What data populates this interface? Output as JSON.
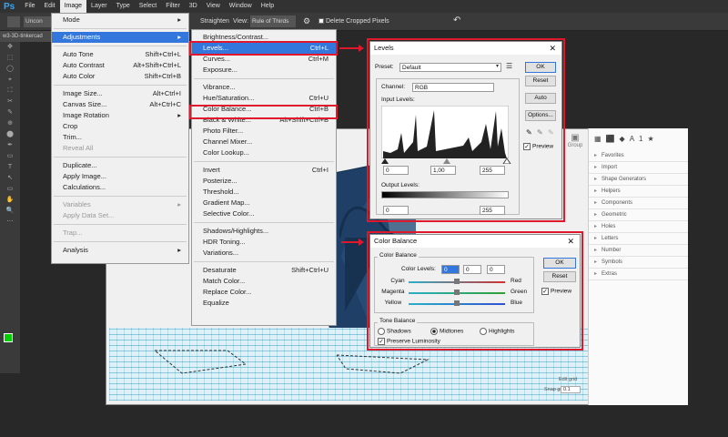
{
  "app": {
    "logo": "Ps"
  },
  "menubar": {
    "items": [
      "File",
      "Edit",
      "Image",
      "Layer",
      "Type",
      "Select",
      "Filter",
      "3D",
      "View",
      "Window",
      "Help"
    ],
    "active": "Image"
  },
  "optbar": {
    "straighten": "Straighten",
    "view_label": "View:",
    "view_value": "Rule of Thirds",
    "delete_cropped": "Delete Cropped Pixels",
    "unconstrained": "Uncon"
  },
  "doc_tab": "w3-3D-tinkercad",
  "image_menu": [
    {
      "label": "Mode",
      "shortcut": "",
      "sub": true
    },
    {
      "sep": true
    },
    {
      "label": "Adjustments",
      "shortcut": "",
      "sub": true,
      "hl": true
    },
    {
      "sep": true
    },
    {
      "label": "Auto Tone",
      "shortcut": "Shift+Ctrl+L"
    },
    {
      "label": "Auto Contrast",
      "shortcut": "Alt+Shift+Ctrl+L"
    },
    {
      "label": "Auto Color",
      "shortcut": "Shift+Ctrl+B"
    },
    {
      "sep": true
    },
    {
      "label": "Image Size...",
      "shortcut": "Alt+Ctrl+I"
    },
    {
      "label": "Canvas Size...",
      "shortcut": "Alt+Ctrl+C"
    },
    {
      "label": "Image Rotation",
      "shortcut": "",
      "sub": true
    },
    {
      "label": "Crop",
      "shortcut": ""
    },
    {
      "label": "Trim...",
      "shortcut": ""
    },
    {
      "label": "Reveal All",
      "shortcut": "",
      "dis": true
    },
    {
      "sep": true
    },
    {
      "label": "Duplicate...",
      "shortcut": ""
    },
    {
      "label": "Apply Image...",
      "shortcut": ""
    },
    {
      "label": "Calculations...",
      "shortcut": ""
    },
    {
      "sep": true
    },
    {
      "label": "Variables",
      "shortcut": "",
      "sub": true,
      "dis": true
    },
    {
      "label": "Apply Data Set...",
      "shortcut": "",
      "dis": true
    },
    {
      "sep": true
    },
    {
      "label": "Trap...",
      "shortcut": "",
      "dis": true
    },
    {
      "sep": true
    },
    {
      "label": "Analysis",
      "shortcut": "",
      "sub": true
    }
  ],
  "adjust_menu": [
    {
      "label": "Brightness/Contrast...",
      "shortcut": ""
    },
    {
      "label": "Levels...",
      "shortcut": "Ctrl+L",
      "hl": true
    },
    {
      "label": "Curves...",
      "shortcut": "Ctrl+M"
    },
    {
      "label": "Exposure...",
      "shortcut": ""
    },
    {
      "sep": true
    },
    {
      "label": "Vibrance...",
      "shortcut": ""
    },
    {
      "label": "Hue/Saturation...",
      "shortcut": "Ctrl+U"
    },
    {
      "label": "Color Balance...",
      "shortcut": "Ctrl+B"
    },
    {
      "label": "Black & White...",
      "shortcut": "Alt+Shift+Ctrl+B"
    },
    {
      "label": "Photo Filter...",
      "shortcut": ""
    },
    {
      "label": "Channel Mixer...",
      "shortcut": ""
    },
    {
      "label": "Color Lookup...",
      "shortcut": ""
    },
    {
      "sep": true
    },
    {
      "label": "Invert",
      "shortcut": "Ctrl+I"
    },
    {
      "label": "Posterize...",
      "shortcut": ""
    },
    {
      "label": "Threshold...",
      "shortcut": ""
    },
    {
      "label": "Gradient Map...",
      "shortcut": ""
    },
    {
      "label": "Selective Color...",
      "shortcut": ""
    },
    {
      "sep": true
    },
    {
      "label": "Shadows/Highlights...",
      "shortcut": ""
    },
    {
      "label": "HDR Toning...",
      "shortcut": ""
    },
    {
      "label": "Variations...",
      "shortcut": ""
    },
    {
      "sep": true
    },
    {
      "label": "Desaturate",
      "shortcut": "Shift+Ctrl+U"
    },
    {
      "label": "Match Color...",
      "shortcut": ""
    },
    {
      "label": "Replace Color...",
      "shortcut": ""
    },
    {
      "label": "Equalize",
      "shortcut": ""
    }
  ],
  "levels": {
    "title": "Levels",
    "preset_label": "Preset:",
    "preset_value": "Default",
    "channel_label": "Channel:",
    "channel_value": "RGB",
    "input_label": "Input Levels:",
    "input_values": [
      "0",
      "1,00",
      "255"
    ],
    "output_label": "Output Levels:",
    "output_values": [
      "0",
      "255"
    ],
    "ok": "OK",
    "reset": "Reset",
    "auto": "Auto",
    "options": "Options...",
    "preview": "Preview"
  },
  "color_balance": {
    "title": "Color Balance",
    "group": "Color Balance",
    "levels_label": "Color Levels:",
    "levels_values": [
      "0",
      "0",
      "0"
    ],
    "sliders": [
      {
        "left": "Cyan",
        "right": "Red",
        "color": "#d23030"
      },
      {
        "left": "Magenta",
        "right": "Green",
        "color": "#30a030"
      },
      {
        "left": "Yellow",
        "right": "Blue",
        "color": "#3050d0"
      }
    ],
    "tone_group": "Tone Balance",
    "tones": [
      "Shadows",
      "Midtones",
      "Highlights"
    ],
    "selected_tone": "Midtones",
    "preserve": "Preserve Luminosity",
    "ok": "OK",
    "reset": "Reset",
    "preview": "Preview"
  },
  "right_panel": [
    "Favorites",
    "Import",
    "Shape Generators",
    "Helpers",
    "Components",
    "Geometric",
    "Holes",
    "Letters",
    "Number",
    "Symbols",
    "Extras"
  ],
  "panel_header": "Group",
  "grid_label1": "Edit grid",
  "grid_label2": "Snap grid",
  "snap_value": "0.1"
}
